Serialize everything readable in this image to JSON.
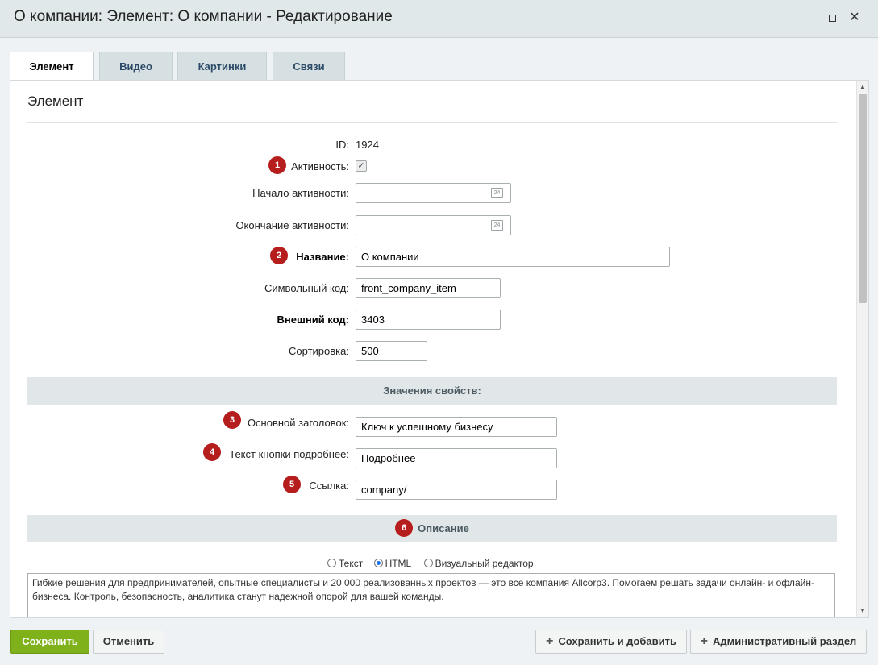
{
  "window": {
    "title": "О компании: Элемент: О компании - Редактирование",
    "maximize_icon": "maximize-icon",
    "close_icon": "close-icon",
    "close_glyph": "✕"
  },
  "tabs": [
    {
      "label": "Элемент",
      "active": true
    },
    {
      "label": "Видео",
      "active": false
    },
    {
      "label": "Картинки",
      "active": false
    },
    {
      "label": "Связи",
      "active": false
    }
  ],
  "section_title": "Элемент",
  "fields": {
    "id_label": "ID:",
    "id_value": "1924",
    "active_label": "Активность:",
    "active_checked": true,
    "active_check_glyph": "✓",
    "start_label": "Начало активности:",
    "start_value": "",
    "end_label": "Окончание активности:",
    "end_value": "",
    "calendar_text": "24",
    "name_label": "Название:",
    "name_value": "О компании",
    "code_label": "Символьный код:",
    "code_value": "front_company_item",
    "ext_label": "Внешний код:",
    "ext_value": "3403",
    "sort_label": "Сортировка:",
    "sort_value": "500"
  },
  "properties": {
    "header": "Значения свойств:",
    "title_label": "Основной заголовок:",
    "title_value": "Ключ к успешному бизнесу",
    "button_label": "Текст кнопки подробнее:",
    "button_value": "Подробнее",
    "link_label": "Ссылка:",
    "link_value": "company/"
  },
  "description": {
    "header": "Описание",
    "modes": [
      {
        "label": "Текст",
        "selected": false
      },
      {
        "label": "HTML",
        "selected": true
      },
      {
        "label": "Визуальный редактор",
        "selected": false
      }
    ],
    "text": "Гибкие решения для предпринимателей, опытные специалисты и 20 000 реализованных проектов — это все компания Allcorp3. Помогаем решать задачи онлайн- и офлайн-бизнеса. Контроль, безопасность, аналитика станут надежной опорой для вашей команды."
  },
  "badges": [
    "1",
    "2",
    "3",
    "4",
    "5",
    "6"
  ],
  "buttons": {
    "save": "Сохранить",
    "cancel": "Отменить",
    "save_add": "Сохранить и добавить",
    "admin": "Административный раздел",
    "plus_glyph": "+"
  },
  "colors": {
    "accent_green": "#7fb21a",
    "badge_red": "#b61d1d"
  }
}
